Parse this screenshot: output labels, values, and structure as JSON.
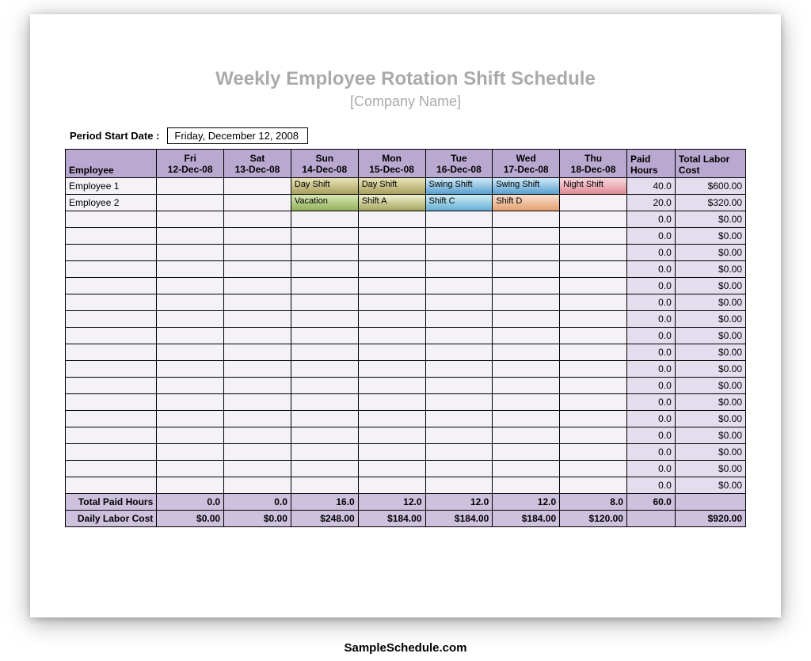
{
  "title": "Weekly Employee Rotation Shift Schedule",
  "subtitle": "[Company Name]",
  "period_label": "Period Start Date :",
  "period_value": "Friday, December 12, 2008",
  "footer": "SampleSchedule.com",
  "colors": {
    "day_shift": "linear-gradient(#e9e4b6,#a9a060)",
    "swing_shift": "linear-gradient(#cfeaf8,#5aa0d0)",
    "night_shift": "linear-gradient(#f8d9de,#e08a95)",
    "vacation": "linear-gradient(#d8e8b8,#94b05a)",
    "shift_a": "linear-gradient(#f0f0d0,#a5a560)",
    "shift_c": "linear-gradient(#d0ecf5,#66b0d5)",
    "shift_d": "linear-gradient(#f8e0d0,#e5a070)"
  },
  "headers": {
    "employee": "Employee",
    "days": [
      {
        "day": "Fri",
        "date": "12-Dec-08"
      },
      {
        "day": "Sat",
        "date": "13-Dec-08"
      },
      {
        "day": "Sun",
        "date": "14-Dec-08"
      },
      {
        "day": "Mon",
        "date": "15-Dec-08"
      },
      {
        "day": "Tue",
        "date": "16-Dec-08"
      },
      {
        "day": "Wed",
        "date": "17-Dec-08"
      },
      {
        "day": "Thu",
        "date": "18-Dec-08"
      }
    ],
    "paid_hours": "Paid Hours",
    "total_cost": "Total Labor Cost"
  },
  "rows": [
    {
      "name": "Employee 1",
      "shifts": [
        null,
        null,
        {
          "label": "Day Shift",
          "c": "day_shift"
        },
        {
          "label": "Day Shift",
          "c": "day_shift"
        },
        {
          "label": "Swing Shift",
          "c": "swing_shift"
        },
        {
          "label": "Swing Shift",
          "c": "swing_shift"
        },
        {
          "label": "Night Shift",
          "c": "night_shift"
        }
      ],
      "paid": "40.0",
      "cost": "$600.00"
    },
    {
      "name": "Employee 2",
      "shifts": [
        null,
        null,
        {
          "label": "Vacation",
          "c": "vacation"
        },
        {
          "label": "Shift A",
          "c": "shift_a"
        },
        {
          "label": "Shift C",
          "c": "shift_c"
        },
        {
          "label": "Shift  D",
          "c": "shift_d"
        },
        null
      ],
      "paid": "20.0",
      "cost": "$320.00"
    },
    {
      "name": "",
      "shifts": [
        null,
        null,
        null,
        null,
        null,
        null,
        null
      ],
      "paid": "0.0",
      "cost": "$0.00"
    },
    {
      "name": "",
      "shifts": [
        null,
        null,
        null,
        null,
        null,
        null,
        null
      ],
      "paid": "0.0",
      "cost": "$0.00"
    },
    {
      "name": "",
      "shifts": [
        null,
        null,
        null,
        null,
        null,
        null,
        null
      ],
      "paid": "0.0",
      "cost": "$0.00"
    },
    {
      "name": "",
      "shifts": [
        null,
        null,
        null,
        null,
        null,
        null,
        null
      ],
      "paid": "0.0",
      "cost": "$0.00"
    },
    {
      "name": "",
      "shifts": [
        null,
        null,
        null,
        null,
        null,
        null,
        null
      ],
      "paid": "0.0",
      "cost": "$0.00"
    },
    {
      "name": "",
      "shifts": [
        null,
        null,
        null,
        null,
        null,
        null,
        null
      ],
      "paid": "0.0",
      "cost": "$0.00"
    },
    {
      "name": "",
      "shifts": [
        null,
        null,
        null,
        null,
        null,
        null,
        null
      ],
      "paid": "0.0",
      "cost": "$0.00"
    },
    {
      "name": "",
      "shifts": [
        null,
        null,
        null,
        null,
        null,
        null,
        null
      ],
      "paid": "0.0",
      "cost": "$0.00"
    },
    {
      "name": "",
      "shifts": [
        null,
        null,
        null,
        null,
        null,
        null,
        null
      ],
      "paid": "0.0",
      "cost": "$0.00"
    },
    {
      "name": "",
      "shifts": [
        null,
        null,
        null,
        null,
        null,
        null,
        null
      ],
      "paid": "0.0",
      "cost": "$0.00"
    },
    {
      "name": "",
      "shifts": [
        null,
        null,
        null,
        null,
        null,
        null,
        null
      ],
      "paid": "0.0",
      "cost": "$0.00"
    },
    {
      "name": "",
      "shifts": [
        null,
        null,
        null,
        null,
        null,
        null,
        null
      ],
      "paid": "0.0",
      "cost": "$0.00"
    },
    {
      "name": "",
      "shifts": [
        null,
        null,
        null,
        null,
        null,
        null,
        null
      ],
      "paid": "0.0",
      "cost": "$0.00"
    },
    {
      "name": "",
      "shifts": [
        null,
        null,
        null,
        null,
        null,
        null,
        null
      ],
      "paid": "0.0",
      "cost": "$0.00"
    },
    {
      "name": "",
      "shifts": [
        null,
        null,
        null,
        null,
        null,
        null,
        null
      ],
      "paid": "0.0",
      "cost": "$0.00"
    },
    {
      "name": "",
      "shifts": [
        null,
        null,
        null,
        null,
        null,
        null,
        null
      ],
      "paid": "0.0",
      "cost": "$0.00"
    },
    {
      "name": "",
      "shifts": [
        null,
        null,
        null,
        null,
        null,
        null,
        null
      ],
      "paid": "0.0",
      "cost": "$0.00"
    }
  ],
  "totals": {
    "paid_label": "Total Paid Hours",
    "cost_label": "Daily Labor Cost",
    "paid_by_day": [
      "0.0",
      "0.0",
      "16.0",
      "12.0",
      "12.0",
      "12.0",
      "8.0"
    ],
    "cost_by_day": [
      "$0.00",
      "$0.00",
      "$248.00",
      "$184.00",
      "$184.00",
      "$184.00",
      "$120.00"
    ],
    "paid_total": "60.0",
    "cost_total": "$920.00"
  }
}
